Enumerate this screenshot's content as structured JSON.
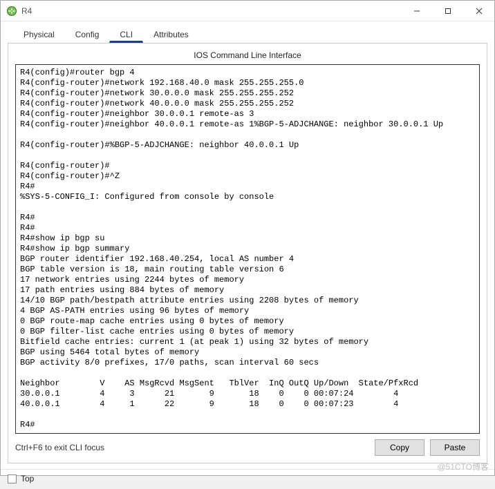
{
  "window": {
    "title": "R4"
  },
  "tabs": {
    "physical": "Physical",
    "config": "Config",
    "cli": "CLI",
    "attributes": "Attributes"
  },
  "panel": {
    "title": "IOS Command Line Interface"
  },
  "cli": {
    "text": "R4(config)#router bgp 4\nR4(config-router)#network 192.168.40.0 mask 255.255.255.0\nR4(config-router)#network 30.0.0.0 mask 255.255.255.252\nR4(config-router)#network 40.0.0.0 mask 255.255.255.252\nR4(config-router)#neighbor 30.0.0.1 remote-as 3\nR4(config-router)#neighbor 40.0.0.1 remote-as 1%BGP-5-ADJCHANGE: neighbor 30.0.0.1 Up\n\nR4(config-router)#%BGP-5-ADJCHANGE: neighbor 40.0.0.1 Up\n\nR4(config-router)#\nR4(config-router)#^Z\nR4#\n%SYS-5-CONFIG_I: Configured from console by console\n\nR4#\nR4#\nR4#show ip bgp su\nR4#show ip bgp summary\nBGP router identifier 192.168.40.254, local AS number 4\nBGP table version is 18, main routing table version 6\n17 network entries using 2244 bytes of memory\n17 path entries using 884 bytes of memory\n14/10 BGP path/bestpath attribute entries using 2208 bytes of memory\n4 BGP AS-PATH entries using 96 bytes of memory\n0 BGP route-map cache entries using 0 bytes of memory\n0 BGP filter-list cache entries using 0 bytes of memory\nBitfield cache entries: current 1 (at peak 1) using 32 bytes of memory\nBGP using 5464 total bytes of memory\nBGP activity 8/0 prefixes, 17/0 paths, scan interval 60 secs\n\nNeighbor        V    AS MsgRcvd MsgSent   TblVer  InQ OutQ Up/Down  State/PfxRcd\n30.0.0.1        4     3      21       9       18    0    0 00:07:24        4\n40.0.0.1        4     1      22       9       18    0    0 00:07:23        4\n\nR4#"
  },
  "footer": {
    "hint": "Ctrl+F6 to exit CLI focus",
    "copy": "Copy",
    "paste": "Paste"
  },
  "bottom": {
    "top_label": "Top"
  },
  "watermark": "@51CTO博客"
}
